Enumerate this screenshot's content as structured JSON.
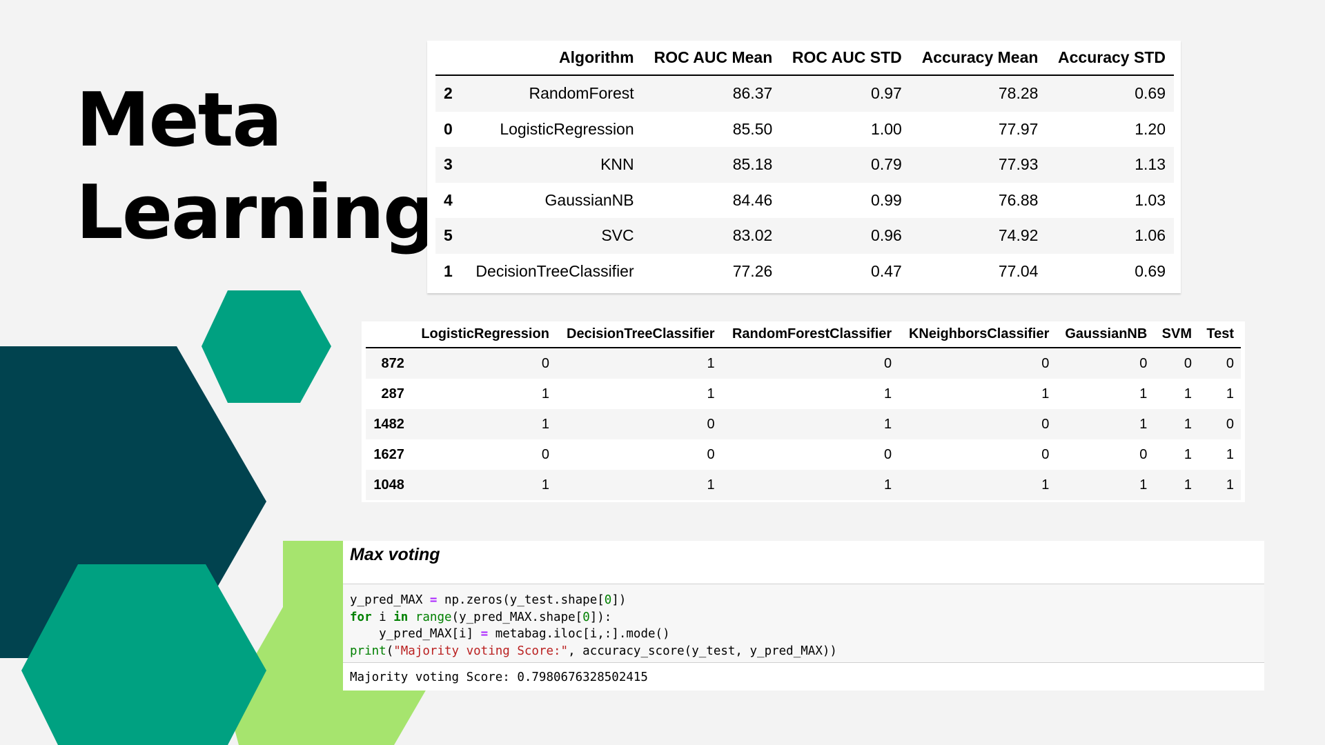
{
  "slide": {
    "title_line1": "Meta",
    "title_line2": "Learning",
    "colors": {
      "background": "#f3f3f3",
      "dark_teal": "#01434f",
      "teal": "#00a181",
      "light_green": "#a6e46e"
    }
  },
  "table1": {
    "headers": [
      "",
      "Algorithm",
      "ROC AUC Mean",
      "ROC AUC STD",
      "Accuracy Mean",
      "Accuracy STD"
    ],
    "rows": [
      [
        "2",
        "RandomForest",
        "86.37",
        "0.97",
        "78.28",
        "0.69"
      ],
      [
        "0",
        "LogisticRegression",
        "85.50",
        "1.00",
        "77.97",
        "1.20"
      ],
      [
        "3",
        "KNN",
        "85.18",
        "0.79",
        "77.93",
        "1.13"
      ],
      [
        "4",
        "GaussianNB",
        "84.46",
        "0.99",
        "76.88",
        "1.03"
      ],
      [
        "5",
        "SVC",
        "83.02",
        "0.96",
        "74.92",
        "1.06"
      ],
      [
        "1",
        "DecisionTreeClassifier",
        "77.26",
        "0.47",
        "77.04",
        "0.69"
      ]
    ]
  },
  "table2": {
    "headers": [
      "",
      "LogisticRegression",
      "DecisionTreeClassifier",
      "RandomForestClassifier",
      "KNeighborsClassifier",
      "GaussianNB",
      "SVM",
      "Test"
    ],
    "rows": [
      [
        "872",
        "0",
        "1",
        "0",
        "0",
        "0",
        "0",
        "0"
      ],
      [
        "287",
        "1",
        "1",
        "1",
        "1",
        "1",
        "1",
        "1"
      ],
      [
        "1482",
        "1",
        "0",
        "1",
        "0",
        "1",
        "1",
        "0"
      ],
      [
        "1627",
        "0",
        "0",
        "0",
        "0",
        "0",
        "1",
        "1"
      ],
      [
        "1048",
        "1",
        "1",
        "1",
        "1",
        "1",
        "1",
        "1"
      ]
    ]
  },
  "notebook": {
    "heading": "Max voting",
    "code_lines": [
      [
        {
          "t": "y_pred_MAX ",
          "c": ""
        },
        {
          "t": "=",
          "c": "op"
        },
        {
          "t": " np.zeros(y_test.shape[",
          "c": ""
        },
        {
          "t": "0",
          "c": "num"
        },
        {
          "t": "])",
          "c": ""
        }
      ],
      [
        {
          "t": "for",
          "c": "kw"
        },
        {
          "t": " i ",
          "c": ""
        },
        {
          "t": "in",
          "c": "kw"
        },
        {
          "t": " ",
          "c": ""
        },
        {
          "t": "range",
          "c": "bi"
        },
        {
          "t": "(y_pred_MAX.shape[",
          "c": ""
        },
        {
          "t": "0",
          "c": "num"
        },
        {
          "t": "]):",
          "c": ""
        }
      ],
      [
        {
          "t": "    y_pred_MAX[i] ",
          "c": ""
        },
        {
          "t": "=",
          "c": "op"
        },
        {
          "t": " metabag.iloc[i,:].mode()",
          "c": ""
        }
      ],
      [
        {
          "t": "print",
          "c": "bi"
        },
        {
          "t": "(",
          "c": ""
        },
        {
          "t": "\"Majority voting Score:\"",
          "c": "str"
        },
        {
          "t": ", accuracy_score(y_test, y_pred_MAX))",
          "c": ""
        }
      ]
    ],
    "output": "Majority voting Score: 0.7980676328502415"
  }
}
